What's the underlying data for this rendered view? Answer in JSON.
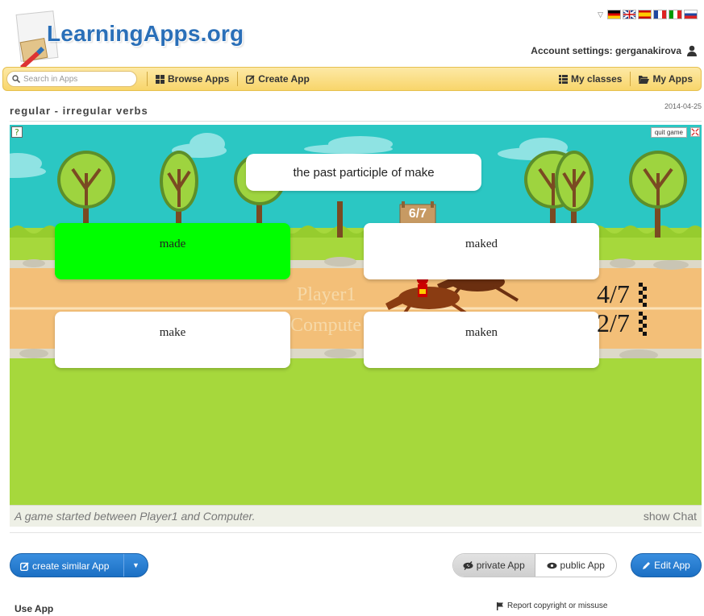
{
  "header": {
    "logo_text": "LearningApps.org",
    "account_text": "Account settings: gerganakirova",
    "flags": [
      "de",
      "en",
      "es",
      "fr",
      "it",
      "ru"
    ]
  },
  "nav": {
    "search_placeholder": "Search in Apps",
    "browse_label": "Browse Apps",
    "create_label": "Create App",
    "classes_label": "My classes",
    "myapps_label": "My Apps"
  },
  "app": {
    "title": "regular - irregular verbs",
    "date": "2014-04-25"
  },
  "game": {
    "quit_label": "quit game",
    "question": "the past participle of make",
    "progress": "6/7",
    "answers": [
      {
        "text": "made",
        "correct": true
      },
      {
        "text": "maked",
        "correct": false
      },
      {
        "text": "make",
        "correct": false
      },
      {
        "text": "maken",
        "correct": false
      }
    ],
    "player1_label": "Player1",
    "computer_label": "Compute",
    "player1_score": "4/7",
    "computer_score": "2/7",
    "status_message": "A game started between Player1 and Computer.",
    "show_chat": "show Chat"
  },
  "actions": {
    "create_similar": "create similar App",
    "private_app": "private App",
    "public_app": "public App",
    "edit_app": "Edit App",
    "use_app": "Use App",
    "report": "Report copyright or missuse"
  },
  "colors": {
    "accent_blue": "#1b6fc4",
    "nav_yellow": "#f8d56a",
    "correct_green": "#00ff00",
    "sky": "#2bc7c3",
    "grass": "#a6d83c"
  }
}
